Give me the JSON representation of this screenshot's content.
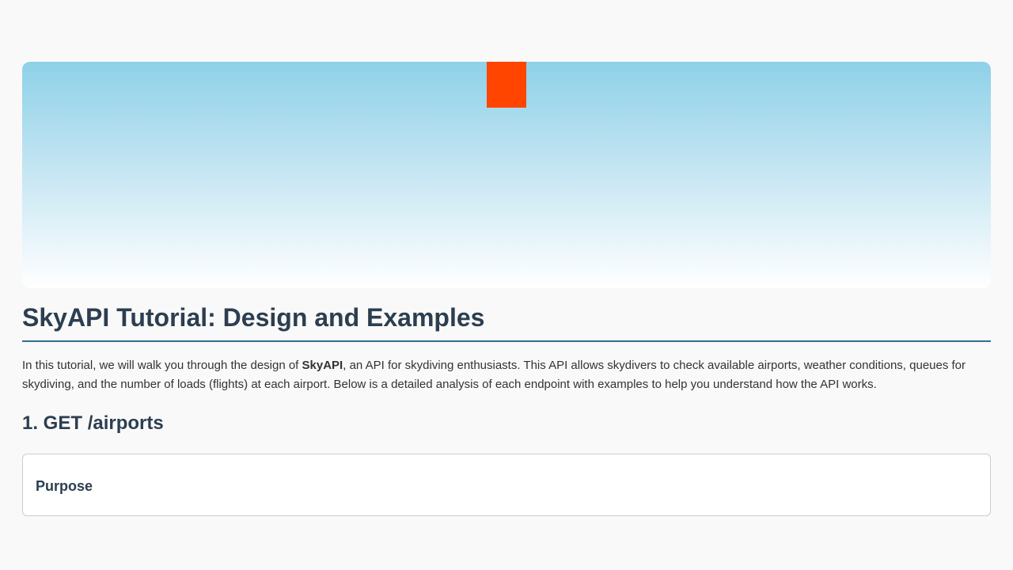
{
  "page": {
    "title": "SkyAPI Tutorial: Design and Examples",
    "intro_prefix": "In this tutorial, we will walk you through the design of ",
    "intro_strong": "SkyAPI",
    "intro_suffix": ", an API for skydiving enthusiasts. This API allows skydivers to check available airports, weather conditions, queues for skydiving, and the number of loads (flights) at each airport. Below is a detailed analysis of each endpoint with examples to help you understand how the API works."
  },
  "sections": [
    {
      "heading": "1. GET /airports",
      "card": {
        "subheading": "Purpose"
      }
    }
  ]
}
